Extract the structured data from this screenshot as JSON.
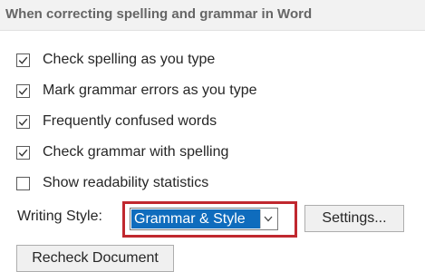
{
  "section": {
    "title": "When correcting spelling and grammar in Word"
  },
  "options": [
    {
      "label": "Check spelling as you type",
      "checked": true
    },
    {
      "label": "Mark grammar errors as you type",
      "checked": true
    },
    {
      "label": "Frequently confused words",
      "checked": true
    },
    {
      "label": "Check grammar with spelling",
      "checked": true
    },
    {
      "label": "Show readability statistics",
      "checked": false
    }
  ],
  "writing_style": {
    "label": "Writing Style:",
    "selected": "Grammar & Style"
  },
  "buttons": {
    "settings": "Settings...",
    "recheck": "Recheck Document"
  },
  "colors": {
    "highlight_box": "#c0282f",
    "selection": "#0f6cbd"
  },
  "icons": {
    "checkmark": "check-icon",
    "dropdown": "chevron-down-icon"
  }
}
